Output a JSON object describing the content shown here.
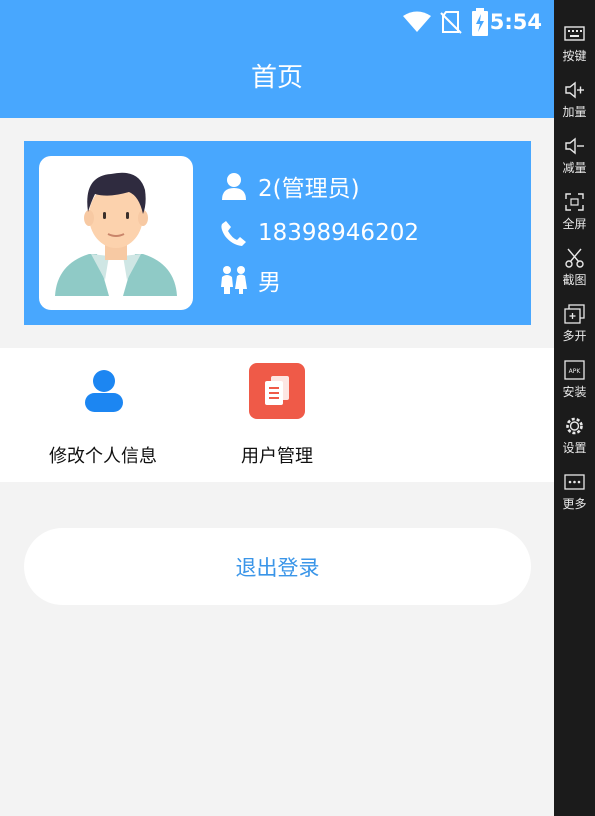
{
  "status_bar": {
    "time": "5:54"
  },
  "header": {
    "title": "首页"
  },
  "profile": {
    "username": "2(管理员)",
    "phone": "18398946202",
    "gender": "男"
  },
  "menu": {
    "items": [
      {
        "label": "修改个人信息",
        "icon": "person-icon"
      },
      {
        "label": "用户管理",
        "icon": "document-icon"
      }
    ]
  },
  "logout": {
    "label": "退出登录"
  },
  "side_toolbar": {
    "items": [
      {
        "label": "按键",
        "icon": "keyboard-icon"
      },
      {
        "label": "加量",
        "icon": "volume-up-icon"
      },
      {
        "label": "减量",
        "icon": "volume-down-icon"
      },
      {
        "label": "全屏",
        "icon": "fullscreen-icon"
      },
      {
        "label": "截图",
        "icon": "scissors-icon"
      },
      {
        "label": "多开",
        "icon": "multi-window-icon"
      },
      {
        "label": "安装",
        "icon": "apk-icon"
      },
      {
        "label": "设置",
        "icon": "settings-icon"
      },
      {
        "label": "更多",
        "icon": "more-icon"
      }
    ]
  },
  "colors": {
    "primary": "#48a7fe",
    "background": "#f3f3f3",
    "logout_text": "#3a95e8",
    "user_icon": "#1c86f2",
    "manage_icon": "#ef5a48",
    "toolbar_bg": "#1b1b1b"
  }
}
